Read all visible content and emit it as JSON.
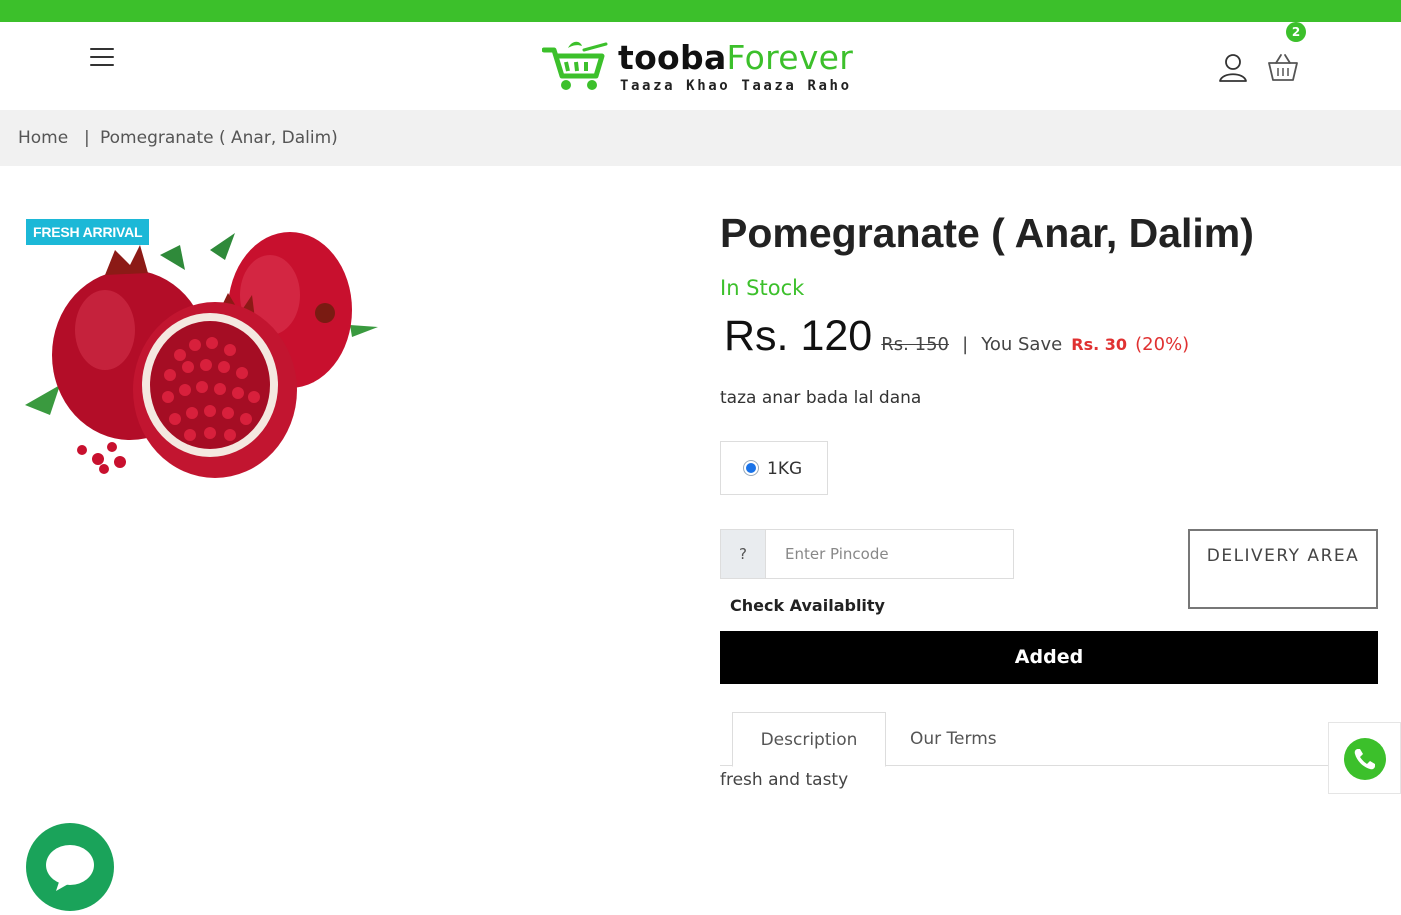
{
  "colors": {
    "brand_green": "#3cc02b",
    "sale_red": "#e03131",
    "fresh_badge": "#1cb8d7",
    "chat_green": "#1aa35a"
  },
  "header": {
    "menu_icon": "hamburger-menu-icon",
    "logo": {
      "brand_part1": "tooba",
      "brand_part2": "Forever",
      "tagline": "Taaza Khao Taaza Raho",
      "icon": "shopping-cart-logo-icon"
    },
    "user_icon": "user-icon",
    "cart_icon": "basket-icon",
    "cart_count": "2"
  },
  "breadcrumb": {
    "home": "Home",
    "separator": "|",
    "current": "Pomegranate ( Anar, Dalim)"
  },
  "product": {
    "badge": "FRESH ARRIVAL",
    "title": "Pomegranate ( Anar, Dalim)",
    "stock_status": "In Stock",
    "price": "Rs. 120",
    "old_price": "Rs. 150",
    "divider": "|",
    "save_label": "You Save",
    "save_amount": "Rs. 30",
    "save_percent": "(20%)",
    "short_description": "taza anar bada lal dana",
    "weight_options": [
      {
        "label": "1KG",
        "selected": true
      }
    ]
  },
  "delivery": {
    "pincode_prefix": "?",
    "pincode_placeholder": "Enter Pincode",
    "pincode_value": "",
    "check_label": "Check Availablity",
    "delivery_button": "DELIVERY AREA"
  },
  "cart_button": {
    "label": "Added"
  },
  "tabs": {
    "items": [
      {
        "label": "Description",
        "active": true
      },
      {
        "label": "Our Terms",
        "active": false
      }
    ],
    "content": "fresh and tasty"
  },
  "floating": {
    "phone_icon": "phone-icon",
    "chat_icon": "chat-bubble-icon"
  }
}
